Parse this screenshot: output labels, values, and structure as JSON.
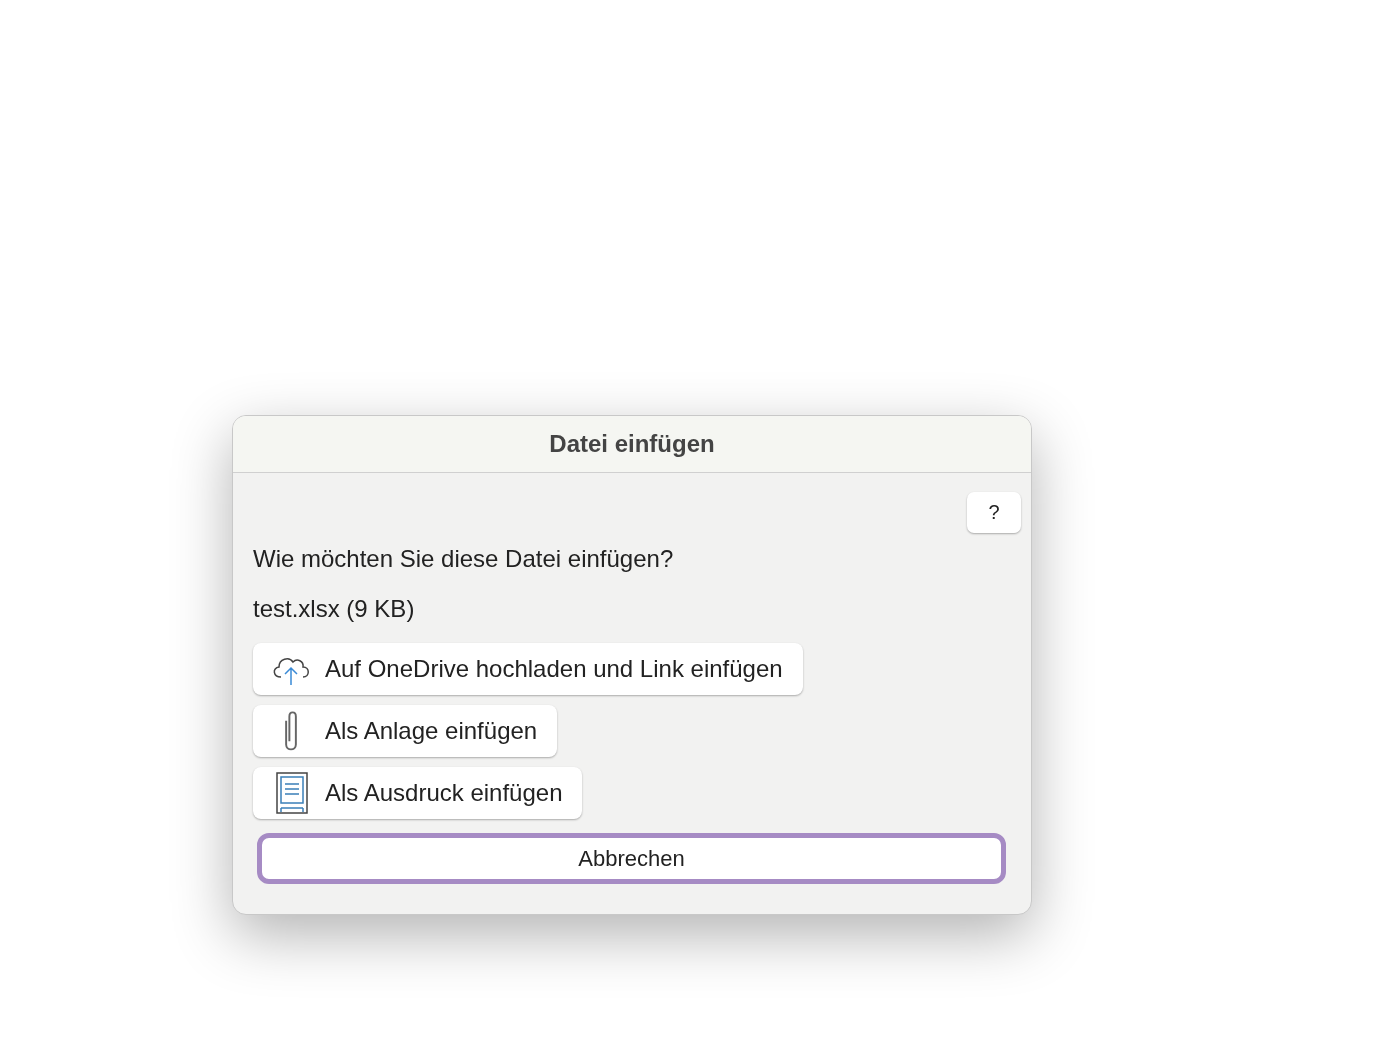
{
  "dialog": {
    "title": "Datei einfügen",
    "help_button": "?",
    "question": "Wie möchten Sie diese Datei einfügen?",
    "file": "test.xlsx (9 KB)",
    "options": [
      {
        "kind": "cloud",
        "label": "Auf OneDrive hochladen und Link einfügen"
      },
      {
        "kind": "paperclip",
        "label": "Als Anlage einfügen"
      },
      {
        "kind": "document",
        "label": "Als Ausdruck einfügen"
      }
    ],
    "cancel_button": {
      "label": "Abbrechen",
      "focused": true
    }
  }
}
